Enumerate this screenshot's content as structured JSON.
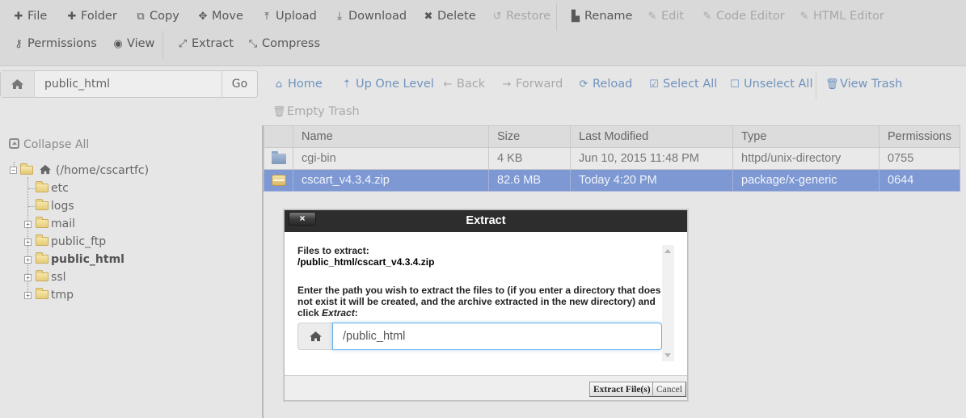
{
  "toolbar": {
    "row1": [
      {
        "label": "File",
        "icon": "plus-icon",
        "disabled": false
      },
      {
        "label": "Folder",
        "icon": "plus-icon",
        "disabled": false
      },
      {
        "label": "Copy",
        "icon": "copy-icon",
        "disabled": false
      },
      {
        "label": "Move",
        "icon": "move-icon",
        "disabled": false
      },
      {
        "label": "Upload",
        "icon": "upload-icon",
        "disabled": false
      },
      {
        "label": "Download",
        "icon": "download-icon",
        "disabled": false
      },
      {
        "label": "Delete",
        "icon": "times-icon",
        "disabled": false
      },
      {
        "label": "Restore",
        "icon": "undo-icon",
        "disabled": true
      },
      {
        "label": "Rename",
        "icon": "file-icon",
        "disabled": false
      },
      {
        "label": "Edit",
        "icon": "pencil-icon",
        "disabled": true
      },
      {
        "label": "Code Editor",
        "icon": "edit-icon",
        "disabled": true
      },
      {
        "label": "HTML Editor",
        "icon": "edit-icon",
        "disabled": true
      }
    ],
    "row2": [
      {
        "label": "Permissions",
        "icon": "key-icon",
        "disabled": false
      },
      {
        "label": "View",
        "icon": "eye-icon",
        "disabled": false
      },
      {
        "label": "Extract",
        "icon": "expand-icon",
        "disabled": false
      },
      {
        "label": "Compress",
        "icon": "compress-icon",
        "disabled": false
      }
    ]
  },
  "pathbar": {
    "value": "public_html",
    "go_label": "Go"
  },
  "nav": [
    {
      "label": "Home",
      "icon": "home-icon",
      "disabled": false
    },
    {
      "label": "Up One Level",
      "icon": "level-up-icon",
      "disabled": false
    },
    {
      "label": "Back",
      "icon": "arrow-left-icon",
      "disabled": true
    },
    {
      "label": "Forward",
      "icon": "arrow-right-icon",
      "disabled": true
    },
    {
      "label": "Reload",
      "icon": "refresh-icon",
      "disabled": false
    },
    {
      "label": "Select All",
      "icon": "check-square-icon",
      "disabled": false
    },
    {
      "label": "Unselect All",
      "icon": "square-icon",
      "disabled": false
    },
    {
      "label": "View Trash",
      "icon": "trash-icon",
      "disabled": false
    },
    {
      "label": "Empty Trash",
      "icon": "trash-icon",
      "disabled": true
    }
  ],
  "tree": {
    "collapse_all": "Collapse All",
    "root": "(/home/cscartfc)",
    "children": [
      {
        "name": "etc",
        "expandable": false,
        "current": false
      },
      {
        "name": "logs",
        "expandable": false,
        "current": false
      },
      {
        "name": "mail",
        "expandable": true,
        "current": false
      },
      {
        "name": "public_ftp",
        "expandable": true,
        "current": false
      },
      {
        "name": "public_html",
        "expandable": true,
        "current": true
      },
      {
        "name": "ssl",
        "expandable": true,
        "current": false
      },
      {
        "name": "tmp",
        "expandable": true,
        "current": false
      }
    ]
  },
  "table": {
    "columns": [
      "Name",
      "Size",
      "Last Modified",
      "Type",
      "Permissions"
    ],
    "rows": [
      {
        "name": "cgi-bin",
        "size": "4 KB",
        "modified": "Jun 10, 2015 11:48 PM",
        "type": "httpd/unix-directory",
        "perms": "0755",
        "kind": "directory",
        "selected": false
      },
      {
        "name": "cscart_v4.3.4.zip",
        "size": "82.6 MB",
        "modified": "Today 4:20 PM",
        "type": "package/x-generic",
        "perms": "0644",
        "kind": "package",
        "selected": true
      }
    ]
  },
  "dialog": {
    "title": "Extract",
    "close_label": "×",
    "files_label": "Files to extract:",
    "files_path": "/public_html/cscart_v4.3.4.zip",
    "instructions_pre": "Enter the path you wish to extract the files to (if you enter a directory that does not exist it will be created, and the archive extracted in the new directory) and click ",
    "instructions_em": "Extract",
    "instructions_post": ":",
    "path_value": "/public_html",
    "extract_button": "Extract File(s)",
    "cancel_button": "Cancel"
  },
  "colors": {
    "selected_row": "#7d98d3",
    "nav_link": "#6f93be",
    "dialog_header": "#2d2d2d",
    "focus_border": "#66afe9"
  }
}
